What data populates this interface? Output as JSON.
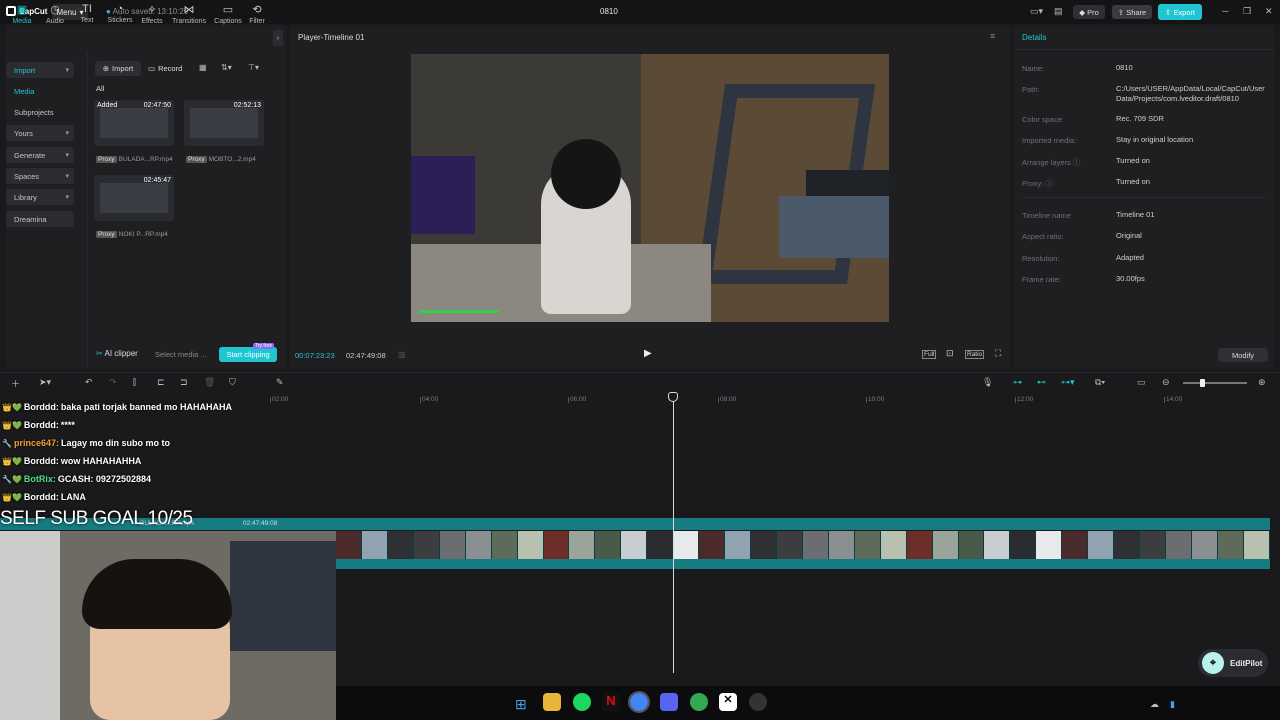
{
  "app": {
    "brand": "CapCut",
    "menu_label": "Menu",
    "autosave": "Auto saved: 13:10:29",
    "title": "0810",
    "pro_label": "Pro",
    "share_label": "Share",
    "export_label": "Export"
  },
  "toolbar": {
    "tabs": [
      {
        "label": "Media",
        "icon": "media-icon"
      },
      {
        "label": "Audio",
        "icon": "audio-icon"
      },
      {
        "label": "Text",
        "icon": "text-icon"
      },
      {
        "label": "Stickers",
        "icon": "stickers-icon"
      },
      {
        "label": "Effects",
        "icon": "effects-icon"
      },
      {
        "label": "Transitions",
        "icon": "transitions-icon"
      },
      {
        "label": "Captions",
        "icon": "captions-icon"
      },
      {
        "label": "Filter",
        "icon": "filters-icon"
      }
    ]
  },
  "sidebar": {
    "items": [
      {
        "label": "Import"
      },
      {
        "label": "Media"
      },
      {
        "label": "Subprojects"
      },
      {
        "label": "Yours"
      },
      {
        "label": "Generate"
      },
      {
        "label": "Spaces"
      },
      {
        "label": "Library"
      },
      {
        "label": "Dreamina"
      }
    ]
  },
  "media": {
    "import_label": "Import",
    "record_label": "Record",
    "filter_all": "All",
    "items": [
      {
        "tag": "Added",
        "duration": "02:47:50",
        "proxy": "Proxy",
        "name": "BULADA...RP.mp4"
      },
      {
        "tag": "",
        "duration": "02:52:13",
        "proxy": "Proxy",
        "name": "MOBTO...2.mp4"
      },
      {
        "tag": "",
        "duration": "02:45:47",
        "proxy": "Proxy",
        "name": "NOKI P...RP.mp4"
      }
    ],
    "ai_clipper": "AI clipper",
    "select_media": "Select media ...",
    "start_clipping": "Start clipping",
    "try_free": "Try free"
  },
  "player": {
    "title": "Player-Timeline 01",
    "current_time": "00:07:23:23",
    "total_time": "02:47:49:08",
    "full_label": "Full",
    "ratio_label": "Ratio"
  },
  "details": {
    "title": "Details",
    "rows": [
      {
        "key": "Name:",
        "value": "0810"
      },
      {
        "key": "Path:",
        "value": "C:/Users/USER/AppData/Local/CapCut/User Data/Projects/com.lveditor.draft/0810"
      },
      {
        "key": "Color space",
        "value": "Rec. 709 SDR"
      },
      {
        "key": "Imported media:",
        "value": "Stay in original location"
      },
      {
        "key": "Arrange layers",
        "value": "Turned on"
      },
      {
        "key": "Proxy:",
        "value": "Turned on"
      },
      {
        "key": "Timeline name",
        "value": "Timeline 01"
      },
      {
        "key": "Aspect ratio:",
        "value": "Original"
      },
      {
        "key": "Resolution:",
        "value": "Adapted"
      },
      {
        "key": "Frame rate:",
        "value": "30.00fps"
      }
    ],
    "modify_label": "Modify"
  },
  "timeline": {
    "ruler": [
      "02:00",
      "04:00",
      "06:00",
      "08:00",
      "10:00",
      "12:00",
      "14:00"
    ],
    "clip_label": "BULADA...RP.mp4",
    "clip_duration": "02:47:49:08"
  },
  "overlay": {
    "chat": [
      {
        "badges": "👑💚",
        "user": "Borddd:",
        "text": "baka pati torjak banned mo HAHAHAHA",
        "color": "#ffffff"
      },
      {
        "badges": "👑💚",
        "user": "Borddd:",
        "text": "****",
        "color": "#ffffff"
      },
      {
        "badges": "🔧",
        "user": "prince647:",
        "text": "Lagay mo din subo mo to",
        "color": "#f0a030"
      },
      {
        "badges": "👑💚",
        "user": "Borddd:",
        "text": "wow HAHAHAHHA",
        "color": "#ffffff"
      },
      {
        "badges": "🔧💚",
        "user": "BotRix:",
        "text": "GCASH: 09272502884",
        "color": "#53e08a"
      },
      {
        "badges": "👑💚",
        "user": "Borddd:",
        "text": "LANA",
        "color": "#ffffff"
      }
    ],
    "goal": "SELF SUB GOAL 10/25"
  },
  "editpilot": {
    "label": "EditPilot"
  },
  "colors": {
    "accent": "#1fc6d2"
  }
}
